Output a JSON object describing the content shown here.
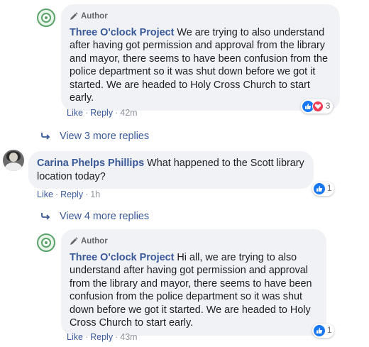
{
  "comments": [
    {
      "author": "Three O'clock Project",
      "author_badge": "Author",
      "text": "We are trying to also understand after having got permission and approval from the library and mayor, there seems to have been confusion from the police department so it was shut down before we got it started. We are headed to Holy Cross Church to start early.",
      "actions": {
        "like": "Like",
        "reply": "Reply",
        "time": "42m"
      },
      "reaction_count": "3",
      "reaction_icons": [
        "like-icon",
        "love-icon"
      ]
    },
    {
      "author": "Carina Phelps Phillips",
      "text": "What happened to the Scott library location today?",
      "actions": {
        "like": "Like",
        "reply": "Reply",
        "time": "1h"
      },
      "reaction_count": "1",
      "reaction_icons": [
        "like-icon"
      ]
    },
    {
      "author": "Three O'clock Project",
      "author_badge": "Author",
      "text": "Hi all, we are trying to also understand after having got permission and approval from the library and mayor, there seems to have been confusion from the police department so it was shut down before we got it started. We are headed to Holy Cross Church to start early.",
      "actions": {
        "like": "Like",
        "reply": "Reply",
        "time": "43m"
      },
      "reaction_count": "1",
      "reaction_icons": [
        "like-icon"
      ]
    }
  ],
  "more_replies": [
    {
      "label": "View 3 more replies"
    },
    {
      "label": "View 4 more replies"
    }
  ],
  "colors": {
    "link": "#385898",
    "bubble": "#f0f2f5",
    "like_blue": "#1877f2",
    "love_red": "#f33e58"
  }
}
